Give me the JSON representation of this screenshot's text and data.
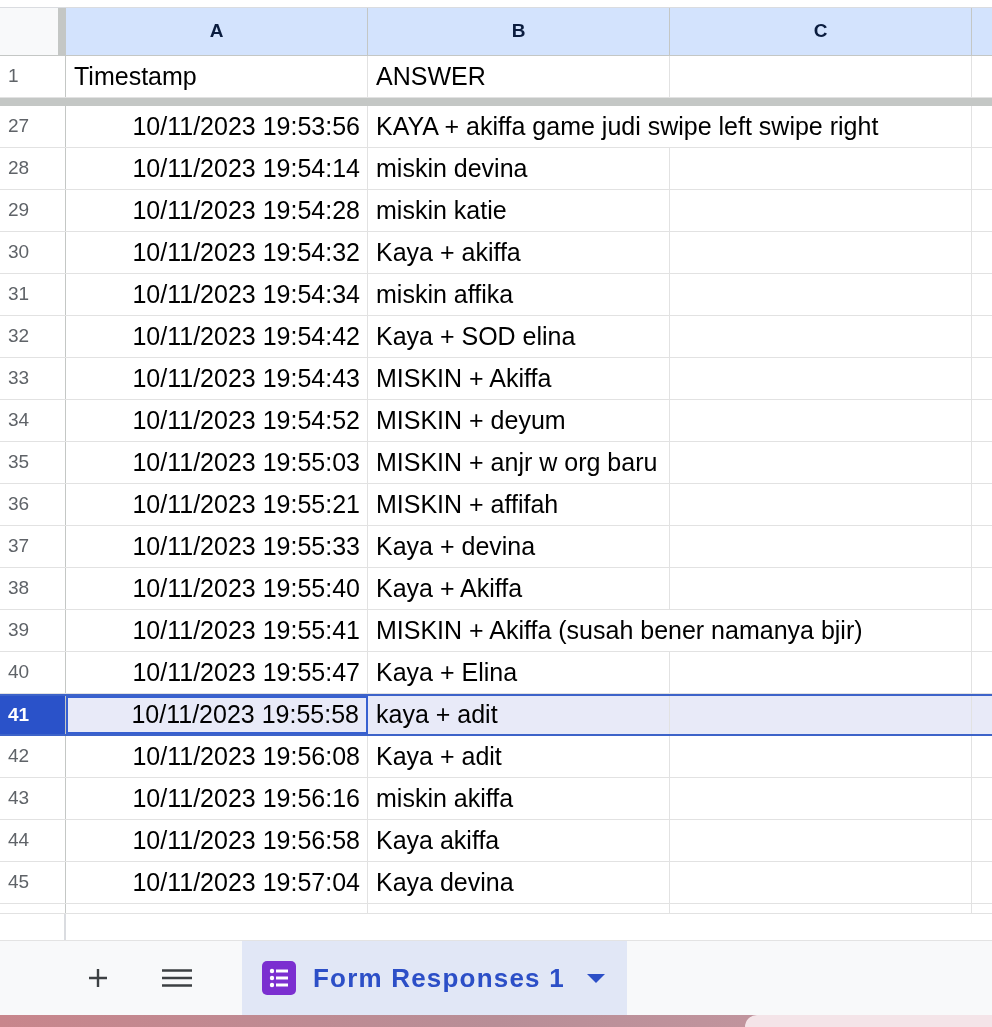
{
  "column_headers": [
    {
      "label": "A"
    },
    {
      "label": "B"
    },
    {
      "label": "C"
    }
  ],
  "frozen_rows": [
    {
      "number": "1",
      "selected": false,
      "cells": [
        {
          "kind": "text",
          "text": "Timestamp",
          "active": false
        },
        {
          "kind": "text",
          "text": "ANSWER",
          "active": false
        }
      ]
    }
  ],
  "rows": [
    {
      "number": "27",
      "selected": false,
      "cells": [
        {
          "kind": "date",
          "text": "10/11/2023 19:53:56",
          "active": false
        },
        {
          "kind": "text",
          "text": "KAYA + akiffa game judi swipe left swipe right",
          "active": false
        }
      ]
    },
    {
      "number": "28",
      "selected": false,
      "cells": [
        {
          "kind": "date",
          "text": "10/11/2023 19:54:14",
          "active": false
        },
        {
          "kind": "text",
          "text": "miskin devina",
          "active": false
        }
      ]
    },
    {
      "number": "29",
      "selected": false,
      "cells": [
        {
          "kind": "date",
          "text": "10/11/2023 19:54:28",
          "active": false
        },
        {
          "kind": "text",
          "text": "miskin katie",
          "active": false
        }
      ]
    },
    {
      "number": "30",
      "selected": false,
      "cells": [
        {
          "kind": "date",
          "text": "10/11/2023 19:54:32",
          "active": false
        },
        {
          "kind": "text",
          "text": "Kaya + akiffa",
          "active": false
        }
      ]
    },
    {
      "number": "31",
      "selected": false,
      "cells": [
        {
          "kind": "date",
          "text": "10/11/2023 19:54:34",
          "active": false
        },
        {
          "kind": "text",
          "text": "miskin affika",
          "active": false
        }
      ]
    },
    {
      "number": "32",
      "selected": false,
      "cells": [
        {
          "kind": "date",
          "text": "10/11/2023 19:54:42",
          "active": false
        },
        {
          "kind": "text",
          "text": "Kaya + SOD elina",
          "active": false
        }
      ]
    },
    {
      "number": "33",
      "selected": false,
      "cells": [
        {
          "kind": "date",
          "text": "10/11/2023 19:54:43",
          "active": false
        },
        {
          "kind": "text",
          "text": "MISKIN + Akiffa",
          "active": false
        }
      ]
    },
    {
      "number": "34",
      "selected": false,
      "cells": [
        {
          "kind": "date",
          "text": "10/11/2023 19:54:52",
          "active": false
        },
        {
          "kind": "text",
          "text": "MISKIN + deyum",
          "active": false
        }
      ]
    },
    {
      "number": "35",
      "selected": false,
      "cells": [
        {
          "kind": "date",
          "text": "10/11/2023 19:55:03",
          "active": false
        },
        {
          "kind": "text",
          "text": "MISKIN + anjr w org baru",
          "active": false
        }
      ]
    },
    {
      "number": "36",
      "selected": false,
      "cells": [
        {
          "kind": "date",
          "text": "10/11/2023 19:55:21",
          "active": false
        },
        {
          "kind": "text",
          "text": "MISKIN + affifah",
          "active": false
        }
      ]
    },
    {
      "number": "37",
      "selected": false,
      "cells": [
        {
          "kind": "date",
          "text": "10/11/2023 19:55:33",
          "active": false
        },
        {
          "kind": "text",
          "text": "Kaya + devina",
          "active": false
        }
      ]
    },
    {
      "number": "38",
      "selected": false,
      "cells": [
        {
          "kind": "date",
          "text": "10/11/2023 19:55:40",
          "active": false
        },
        {
          "kind": "text",
          "text": "Kaya + Akiffa",
          "active": false
        }
      ]
    },
    {
      "number": "39",
      "selected": false,
      "cells": [
        {
          "kind": "date",
          "text": "10/11/2023 19:55:41",
          "active": false
        },
        {
          "kind": "text",
          "text": "MISKIN + Akiffa (susah bener namanya bjir)",
          "active": false
        }
      ]
    },
    {
      "number": "40",
      "selected": false,
      "cells": [
        {
          "kind": "date",
          "text": "10/11/2023 19:55:47",
          "active": false
        },
        {
          "kind": "text",
          "text": "Kaya + Elina",
          "active": false
        }
      ]
    },
    {
      "number": "41",
      "selected": true,
      "cells": [
        {
          "kind": "date",
          "text": "10/11/2023 19:55:58",
          "active": true
        },
        {
          "kind": "text",
          "text": "kaya + adit",
          "active": false
        }
      ]
    },
    {
      "number": "42",
      "selected": false,
      "cells": [
        {
          "kind": "date",
          "text": "10/11/2023 19:56:08",
          "active": false
        },
        {
          "kind": "text",
          "text": "Kaya + adit",
          "active": false
        }
      ]
    },
    {
      "number": "43",
      "selected": false,
      "cells": [
        {
          "kind": "date",
          "text": "10/11/2023 19:56:16",
          "active": false
        },
        {
          "kind": "text",
          "text": "miskin akiffa",
          "active": false
        }
      ]
    },
    {
      "number": "44",
      "selected": false,
      "cells": [
        {
          "kind": "date",
          "text": "10/11/2023 19:56:58",
          "active": false
        },
        {
          "kind": "text",
          "text": "Kaya akiffa",
          "active": false
        }
      ]
    },
    {
      "number": "45",
      "selected": false,
      "cells": [
        {
          "kind": "date",
          "text": "10/11/2023 19:57:04",
          "active": false
        },
        {
          "kind": "text",
          "text": "Kaya devina",
          "active": false
        }
      ]
    }
  ],
  "sheet_tabs": [
    {
      "label": "Form Responses 1",
      "selected": true
    }
  ]
}
